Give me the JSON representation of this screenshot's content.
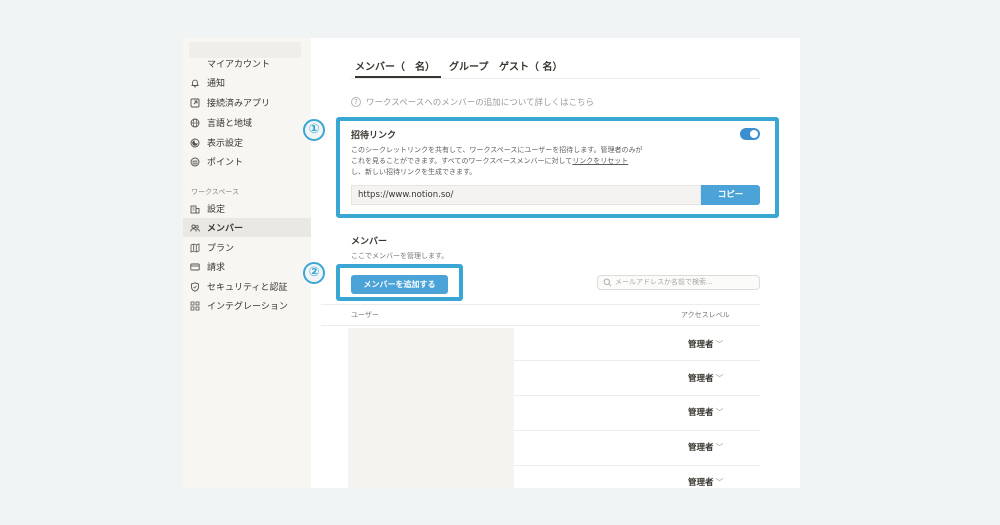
{
  "sidebar": {
    "account_label": "マイアカウント",
    "account_items": [
      {
        "label": "通知",
        "icon": "bell-icon"
      },
      {
        "label": "接続済みアプリ",
        "icon": "external-link-icon"
      },
      {
        "label": "言語と地域",
        "icon": "globe-icon"
      },
      {
        "label": "表示設定",
        "icon": "moon-icon"
      },
      {
        "label": "ポイント",
        "icon": "gift-icon"
      }
    ],
    "workspace_heading": "ワークスペース",
    "workspace_items": [
      {
        "label": "設定",
        "icon": "building-icon"
      },
      {
        "label": "メンバー",
        "icon": "people-icon",
        "active": true
      },
      {
        "label": "プラン",
        "icon": "map-icon"
      },
      {
        "label": "請求",
        "icon": "credit-card-icon"
      },
      {
        "label": "セキュリティと認証",
        "icon": "shield-icon"
      },
      {
        "label": "インテグレーション",
        "icon": "grid-icon"
      }
    ]
  },
  "tabs": [
    {
      "label": "メンバー（　名）",
      "active": true
    },
    {
      "label": "グループ"
    },
    {
      "label": "ゲスト（ 名）"
    }
  ],
  "help_text": "ワークスペースへのメンバーの追加について詳しくはこちら",
  "invite": {
    "title": "招待リンク",
    "description_1": "このシークレットリンクを共有して、ワークスペースにユーザーを招待します。管理者のみが",
    "description_2": "これを見ることができます。すべてのワークスペースメンバーに対して",
    "reset_link": "リンクをリセット",
    "description_3": "し、新しい招待リンクを生成できます。",
    "url": "https://www.notion.so/",
    "copy_label": "コピー",
    "enabled": true
  },
  "members": {
    "title": "メンバー",
    "subtitle": "ここでメンバーを管理します。",
    "add_label": "メンバーを追加する",
    "search_placeholder": "メールアドレスか名前で検索...",
    "col_user": "ユーザー",
    "col_access": "アクセスレベル",
    "roles": [
      "管理者",
      "管理者",
      "管理者",
      "管理者",
      "管理者"
    ]
  },
  "steps": [
    "①",
    "②"
  ],
  "colors": {
    "accent": "#39a6d4",
    "button": "#4ba3d8",
    "toggle": "#3b8ed0"
  }
}
